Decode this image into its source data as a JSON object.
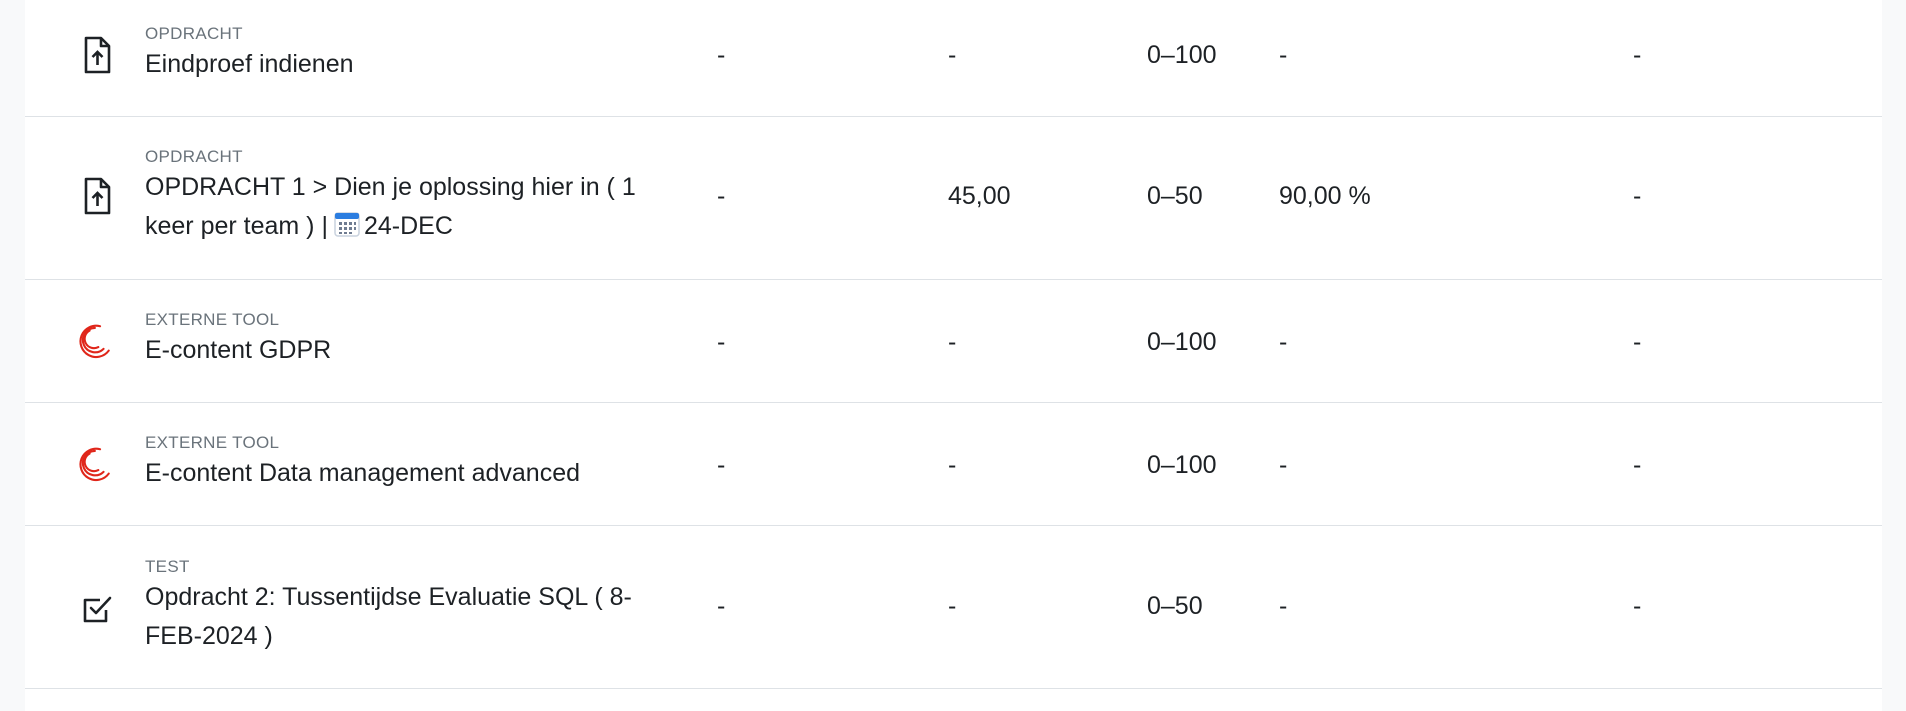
{
  "rows": [
    {
      "type": "OPDRACHT",
      "title": "Eindproef indienen",
      "icon": "assignment-upload-icon",
      "weight": "-",
      "grade": "-",
      "range": "0–100",
      "percentage": "-",
      "feedback": "-"
    },
    {
      "type": "OPDRACHT",
      "title_part1": "OPDRACHT 1 > Dien je oplossing hier in ( 1 keer per team ) |",
      "calendar_icon": "calendar-icon",
      "title_part2": "24-DEC",
      "icon": "assignment-upload-icon",
      "weight": "-",
      "grade": "45,00",
      "range": "0–50",
      "percentage": "90,00 %",
      "feedback": "-"
    },
    {
      "type": "EXTERNE TOOL",
      "title": "E-content GDPR",
      "icon": "external-tool-icon",
      "weight": "-",
      "grade": "-",
      "range": "0–100",
      "percentage": "-",
      "feedback": "-"
    },
    {
      "type": "EXTERNE TOOL",
      "title": "E-content Data management advanced",
      "icon": "external-tool-icon",
      "weight": "-",
      "grade": "-",
      "range": "0–100",
      "percentage": "-",
      "feedback": "-"
    },
    {
      "type": "TEST",
      "title": "Opdracht 2: Tussentijdse Evaluatie SQL ( 8-FEB-2024 )",
      "icon": "quiz-checkbox-icon",
      "weight": "-",
      "grade": "-",
      "range": "0–50",
      "percentage": "-",
      "feedback": "-"
    }
  ],
  "colors": {
    "external_tool_icon": "#e0261a",
    "divider": "#dee2e6",
    "type_label": "#6a737b"
  }
}
